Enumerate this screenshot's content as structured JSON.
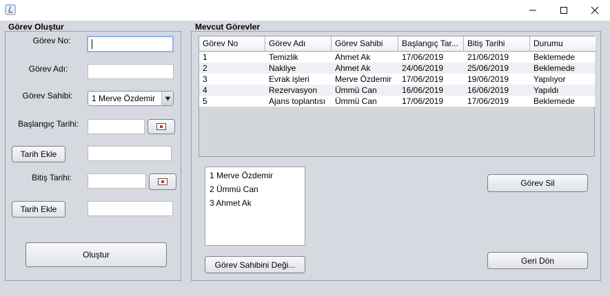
{
  "window": {
    "minimize_icon": "minimize-icon",
    "maximize_icon": "maximize-icon",
    "close_icon": "close-icon"
  },
  "left_panel": {
    "title": "Görev Oluştur",
    "task_no_label": "Görev No:",
    "task_no_value": "",
    "task_name_label": "Görev Adı:",
    "task_name_value": "",
    "owner_label": "Görev Sahibi:",
    "owner_selected": "1  Merve Özdemir",
    "start_date_label": "Başlangıç Tarihi:",
    "start_date_value": "",
    "add_date_button_1": "Tarih Ekle",
    "start_added_value": "",
    "end_date_label": "Bitiş Tarihi:",
    "end_date_value": "",
    "add_date_button_2": "Tarih Ekle",
    "end_added_value": "",
    "create_button": "Oluştur"
  },
  "right_panel": {
    "title": "Mevcut Görevler",
    "table": {
      "columns": [
        "Görev No",
        "Görev Adı",
        "Görev Sahibi",
        "Başlangıç Tar...",
        "Bitiş Tarihi",
        "Durumu"
      ],
      "rows": [
        [
          "1",
          "Temizlik",
          "Ahmet Ak",
          "17/06/2019",
          "21/06/2019",
          "Beklemede"
        ],
        [
          "2",
          "Nakliye",
          "Ahmet Ak",
          "24/06/2019",
          "25/06/2019",
          "Beklemede"
        ],
        [
          "3",
          "Evrak işleri",
          " Merve Özdemir",
          "17/06/2019",
          "19/06/2019",
          "Yapılıyor"
        ],
        [
          "4",
          "Rezervasyon",
          "Ümmü Can",
          "16/06/2019",
          "16/06/2019",
          "Yapıldı"
        ],
        [
          "5",
          "Ajans toplantısı",
          "Ümmü Can",
          "17/06/2019",
          "17/06/2019",
          "Beklemede"
        ]
      ]
    },
    "owners_list": [
      "1  Merve Özdemir",
      "2 Ümmü Can",
      "3 Ahmet Ak"
    ],
    "delete_button": "Görev Sil",
    "change_owner_button": "Görev Sahibini Deği...",
    "back_button": "Geri Dön"
  }
}
